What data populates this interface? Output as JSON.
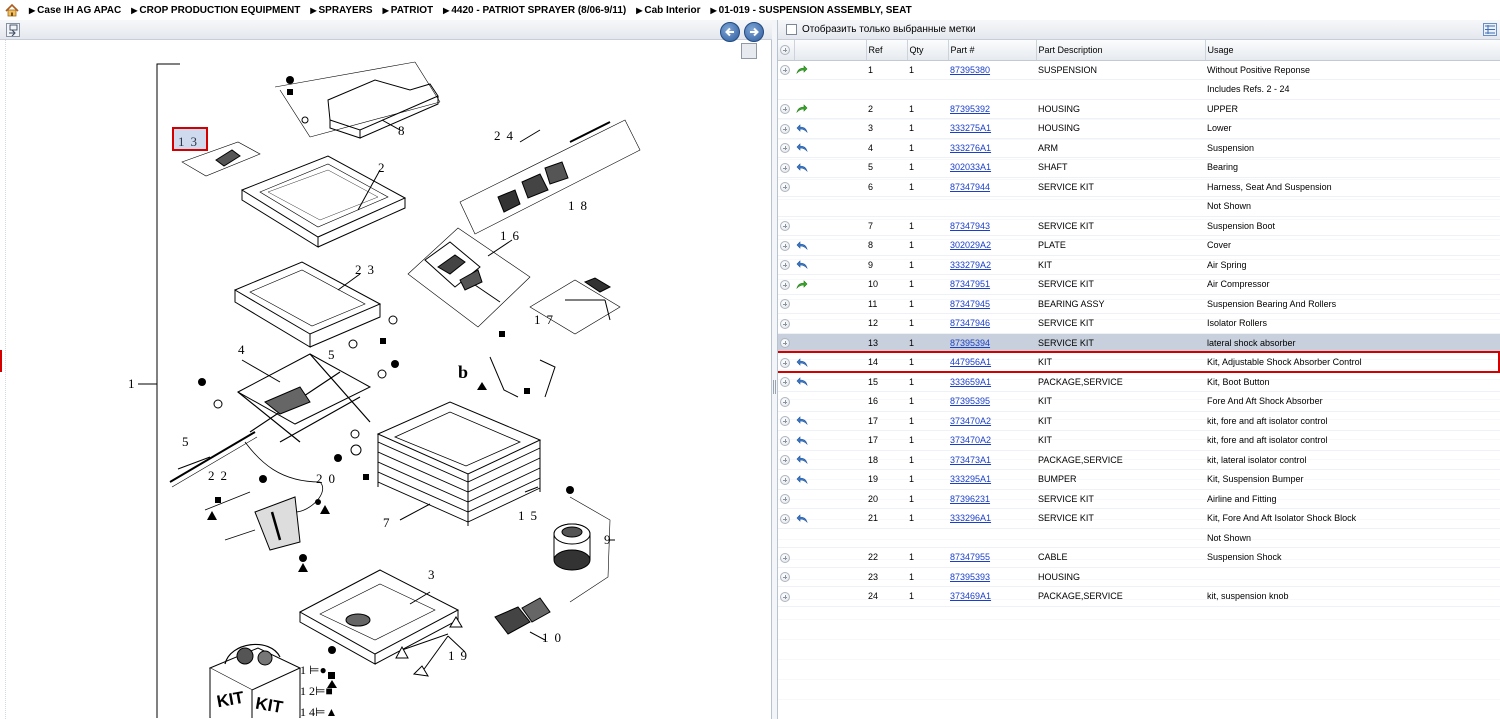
{
  "breadcrumb": [
    {
      "label": "Case IH AG APAC"
    },
    {
      "label": "CROP PRODUCTION EQUIPMENT"
    },
    {
      "label": "SPRAYERS"
    },
    {
      "label": "PATRIOT"
    },
    {
      "label": "4420 - PATRIOT SPRAYER (8/06-9/11)"
    },
    {
      "label": "Cab Interior"
    },
    {
      "label": "01-019 - SUSPENSION ASSEMBLY, SEAT"
    }
  ],
  "right_toolbar": {
    "filter_label": "Отобразить только выбранные метки"
  },
  "table": {
    "headers": [
      "Ref",
      "Qty",
      "Part #",
      "Part Description",
      "Usage"
    ],
    "rows": [
      {
        "ref": "1",
        "qty": "1",
        "part": "87395380",
        "desc": "SUSPENSION",
        "usage": "Without Positive Reponse",
        "icon": "green"
      },
      {
        "ref": "",
        "qty": "",
        "part": "",
        "desc": "",
        "usage": "Includes Refs. 2 - 24",
        "icon": "none"
      },
      {
        "ref": "2",
        "qty": "1",
        "part": "87395392",
        "desc": "HOUSING",
        "usage": "UPPER",
        "icon": "green"
      },
      {
        "ref": "3",
        "qty": "1",
        "part": "333275A1",
        "desc": "HOUSING",
        "usage": "Lower",
        "icon": "blue"
      },
      {
        "ref": "4",
        "qty": "1",
        "part": "333276A1",
        "desc": "ARM",
        "usage": "Suspension",
        "icon": "blue"
      },
      {
        "ref": "5",
        "qty": "1",
        "part": "302033A1",
        "desc": "SHAFT",
        "usage": "Bearing",
        "icon": "blue"
      },
      {
        "ref": "6",
        "qty": "1",
        "part": "87347944",
        "desc": "SERVICE KIT",
        "usage": "Harness, Seat And Suspension",
        "icon": "plus"
      },
      {
        "ref": "",
        "qty": "",
        "part": "",
        "desc": "",
        "usage": "Not Shown",
        "icon": "none"
      },
      {
        "ref": "7",
        "qty": "1",
        "part": "87347943",
        "desc": "SERVICE KIT",
        "usage": "Suspension Boot",
        "icon": "plus"
      },
      {
        "ref": "8",
        "qty": "1",
        "part": "302029A2",
        "desc": "PLATE",
        "usage": "Cover",
        "icon": "blue"
      },
      {
        "ref": "9",
        "qty": "1",
        "part": "333279A2",
        "desc": "KIT",
        "usage": "Air Spring",
        "icon": "blue"
      },
      {
        "ref": "10",
        "qty": "1",
        "part": "87347951",
        "desc": "SERVICE KIT",
        "usage": "Air Compressor",
        "icon": "green"
      },
      {
        "ref": "11",
        "qty": "1",
        "part": "87347945",
        "desc": "BEARING ASSY",
        "usage": "Suspension Bearing And Rollers",
        "icon": "plus"
      },
      {
        "ref": "12",
        "qty": "1",
        "part": "87347946",
        "desc": "SERVICE KIT",
        "usage": "Isolator Rollers",
        "icon": "plus"
      },
      {
        "ref": "13",
        "qty": "1",
        "part": "87395394",
        "desc": "SERVICE KIT",
        "usage": "lateral shock absorber",
        "icon": "plus",
        "selected": true
      },
      {
        "ref": "14",
        "qty": "1",
        "part": "447956A1",
        "desc": "KIT",
        "usage": "Kit, Adjustable Shock Absorber Control",
        "icon": "blue"
      },
      {
        "ref": "15",
        "qty": "1",
        "part": "333659A1",
        "desc": "PACKAGE,SERVICE",
        "usage": "Kit, Boot Button",
        "icon": "blue"
      },
      {
        "ref": "16",
        "qty": "1",
        "part": "87395395",
        "desc": "KIT",
        "usage": "Fore And Aft Shock Absorber",
        "icon": "plus"
      },
      {
        "ref": "17",
        "qty": "1",
        "part": "373470A2",
        "desc": "KIT",
        "usage": "kit, fore and aft isolator control",
        "icon": "blue"
      },
      {
        "ref": "17",
        "qty": "1",
        "part": "373470A2",
        "desc": "KIT",
        "usage": "kit, fore and aft isolator control",
        "icon": "blue"
      },
      {
        "ref": "18",
        "qty": "1",
        "part": "373473A1",
        "desc": "PACKAGE,SERVICE",
        "usage": "kit, lateral isolator control",
        "icon": "blue"
      },
      {
        "ref": "19",
        "qty": "1",
        "part": "333295A1",
        "desc": "BUMPER",
        "usage": "Kit, Suspension Bumper",
        "icon": "blue"
      },
      {
        "ref": "20",
        "qty": "1",
        "part": "87396231",
        "desc": "SERVICE KIT",
        "usage": "Airline and Fitting",
        "icon": "plus"
      },
      {
        "ref": "21",
        "qty": "1",
        "part": "333296A1",
        "desc": "SERVICE KIT",
        "usage": "Kit, Fore And Aft Isolator Shock Block",
        "icon": "blue"
      },
      {
        "ref": "",
        "qty": "",
        "part": "",
        "desc": "",
        "usage": "Not Shown",
        "icon": "none"
      },
      {
        "ref": "22",
        "qty": "1",
        "part": "87347955",
        "desc": "CABLE",
        "usage": "Suspension Shock",
        "icon": "plus"
      },
      {
        "ref": "23",
        "qty": "1",
        "part": "87395393",
        "desc": "HOUSING",
        "usage": "",
        "icon": "plus"
      },
      {
        "ref": "24",
        "qty": "1",
        "part": "373469A1",
        "desc": "PACKAGE,SERVICE",
        "usage": "kit, suspension knob",
        "icon": "plus"
      }
    ]
  },
  "drawing": {
    "callouts": [
      "1",
      "2",
      "3",
      "4",
      "5",
      "5",
      "7",
      "8",
      "9",
      "10",
      "13",
      "15",
      "16",
      "17",
      "18",
      "19",
      "20",
      "22",
      "23",
      "24",
      "b"
    ],
    "kit_label": "KIT",
    "legend": [
      {
        "text": "1 ⊨●"
      },
      {
        "text": "1 2⊨■"
      },
      {
        "text": "1 4⊨▲"
      }
    ]
  }
}
